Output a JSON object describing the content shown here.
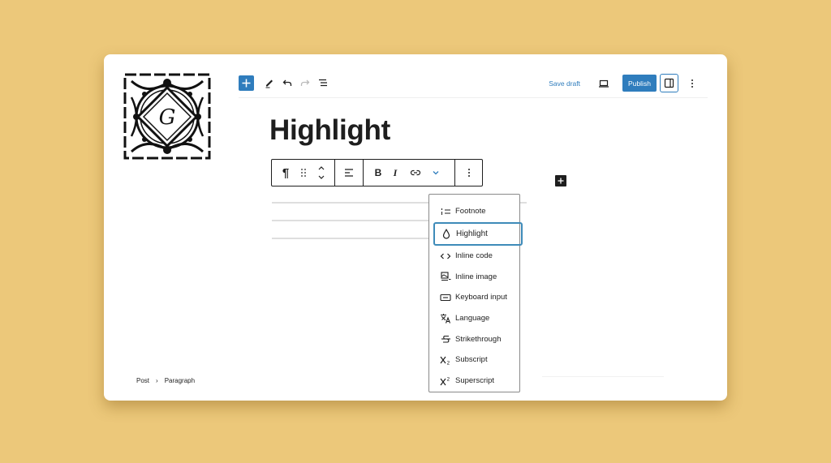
{
  "toolbar": {
    "inserter_icon": "plus-icon",
    "tools_icon": "pencil-icon",
    "undo_icon": "undo-icon",
    "redo_icon": "redo-icon",
    "outline_icon": "list-view-icon",
    "save_draft_label": "Save draft",
    "preview_icon": "laptop-icon",
    "publish_label": "Publish",
    "settings_icon": "sidebar-toggle-icon",
    "options_icon": "more-vertical-icon"
  },
  "post": {
    "title": "Highlight"
  },
  "block_toolbar": {
    "paragraph_icon": "¶",
    "drag_icon": "drag-handle-icon",
    "move_icon": "move-up-down-icon",
    "align_icon": "align-left-icon",
    "bold_label": "B",
    "italic_label": "I",
    "link_icon": "link-icon",
    "more_formats_icon": "chevron-down-icon",
    "options_icon": "more-vertical-icon"
  },
  "format_menu": {
    "items": [
      {
        "label": "Footnote",
        "icon": "footnote-icon",
        "active": false
      },
      {
        "label": "Highlight",
        "icon": "drop-icon",
        "active": true
      },
      {
        "label": "Inline code",
        "icon": "code-icon",
        "active": false
      },
      {
        "label": "Inline image",
        "icon": "image-icon",
        "active": false
      },
      {
        "label": "Keyboard input",
        "icon": "keyboard-icon",
        "active": false
      },
      {
        "label": "Language",
        "icon": "translate-icon",
        "active": false
      },
      {
        "label": "Strikethrough",
        "icon": "strikethrough-icon",
        "active": false
      },
      {
        "label": "Subscript",
        "icon": "subscript-icon",
        "active": false
      },
      {
        "label": "Superscript",
        "icon": "superscript-icon",
        "active": false
      }
    ]
  },
  "breadcrumb": {
    "items": [
      "Post",
      "Paragraph"
    ],
    "separator": "›"
  },
  "colors": {
    "accent": "#2f7dbd",
    "background": "#ecc87a",
    "text": "#1e1e1e"
  }
}
